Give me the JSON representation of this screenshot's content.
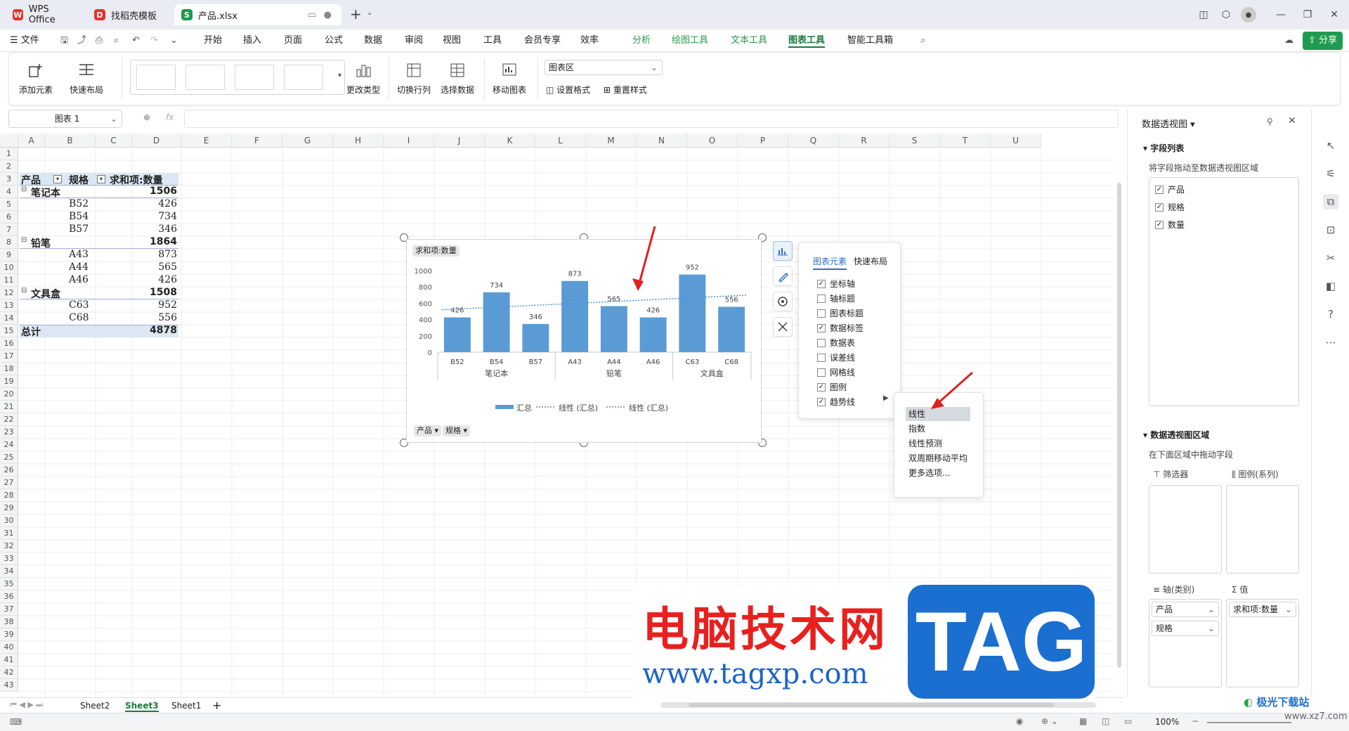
{
  "tabs": {
    "wps": "WPS Office",
    "template": "找稻壳模板",
    "file": "产品.xlsx",
    "new_tab": "+"
  },
  "menu": {
    "file": "文件",
    "items": [
      "开始",
      "插入",
      "页面",
      "公式",
      "数据",
      "审阅",
      "视图",
      "工具",
      "会员专享",
      "效率"
    ],
    "green_items": [
      "分析",
      "绘图工具",
      "文本工具"
    ],
    "active": "图表工具",
    "last": "智能工具箱",
    "share": "分享"
  },
  "ribbon": {
    "add_element": "添加元素",
    "quick_layout": "快速布局",
    "change_type": "更改类型",
    "switch_rowcol": "切换行列",
    "select_data": "选择数据",
    "move_chart": "移动图表",
    "area_select": "图表区",
    "set_format": "设置格式",
    "reset_style": "重置样式"
  },
  "formula": {
    "name_box": "图表 1",
    "fx": "fx"
  },
  "grid": {
    "columns": [
      "A",
      "B",
      "C",
      "D",
      "E",
      "F",
      "G",
      "H",
      "I",
      "J",
      "K",
      "L",
      "M",
      "N",
      "O",
      "P",
      "Q",
      "R",
      "S",
      "T",
      "U"
    ],
    "rows": [
      "1",
      "2",
      "3",
      "4",
      "5",
      "6",
      "7",
      "8",
      "9",
      "10",
      "11",
      "12",
      "13",
      "14",
      "15",
      "16",
      "17",
      "18",
      "19",
      "20",
      "21",
      "22",
      "23",
      "24",
      "25",
      "26",
      "27",
      "28",
      "29",
      "30",
      "31",
      "32",
      "33",
      "34",
      "35",
      "36",
      "37",
      "38",
      "39",
      "40",
      "41",
      "42",
      "43"
    ],
    "pivot": {
      "h_product": "产品",
      "h_spec": "规格",
      "h_sum": "求和项:数量",
      "rows": [
        {
          "a": "笔记本",
          "b": "",
          "c": "1506",
          "kind": "group"
        },
        {
          "a": "",
          "b": "B52",
          "c": "426",
          "kind": "item"
        },
        {
          "a": "",
          "b": "B54",
          "c": "734",
          "kind": "item"
        },
        {
          "a": "",
          "b": "B57",
          "c": "346",
          "kind": "item"
        },
        {
          "a": "铅笔",
          "b": "",
          "c": "1864",
          "kind": "group"
        },
        {
          "a": "",
          "b": "A43",
          "c": "873",
          "kind": "item"
        },
        {
          "a": "",
          "b": "A44",
          "c": "565",
          "kind": "item"
        },
        {
          "a": "",
          "b": "A46",
          "c": "426",
          "kind": "item"
        },
        {
          "a": "文具盒",
          "b": "",
          "c": "1508",
          "kind": "group"
        },
        {
          "a": "",
          "b": "C63",
          "c": "952",
          "kind": "item"
        },
        {
          "a": "",
          "b": "C68",
          "c": "556",
          "kind": "item"
        }
      ],
      "total_label": "总计",
      "total_value": "4878"
    }
  },
  "chart_data": {
    "type": "bar",
    "value_field_button": "求和项:数量",
    "categories": [
      "B52",
      "B54",
      "B57",
      "A43",
      "A44",
      "A46",
      "C63",
      "C68"
    ],
    "groups": [
      {
        "name": "笔记本",
        "count": 3
      },
      {
        "name": "铅笔",
        "count": 3
      },
      {
        "name": "文具盒",
        "count": 2
      }
    ],
    "series": [
      {
        "name": "汇总",
        "values": [
          426,
          734,
          346,
          873,
          565,
          426,
          952,
          556
        ],
        "color": "#5b9bd5"
      }
    ],
    "data_labels": [
      "426",
      "734",
      "346",
      "873",
      "565",
      "426",
      "952",
      "556"
    ],
    "trendline": {
      "type": "linear",
      "color": "#4a90d9"
    },
    "ylim": [
      0,
      1000
    ],
    "y_ticks": [
      "0",
      "200",
      "400",
      "600",
      "800",
      "1000"
    ],
    "legend": {
      "position": "bottom",
      "entries": [
        "汇总",
        "线性 (汇总)",
        "线性 (汇总)"
      ]
    },
    "field_buttons": [
      "产品",
      "规格"
    ]
  },
  "chart_elements_panel": {
    "tab_elements": "图表元素",
    "tab_layout": "快速布局",
    "items": [
      {
        "label": "坐标轴",
        "checked": true
      },
      {
        "label": "轴标题",
        "checked": false
      },
      {
        "label": "图表标题",
        "checked": false
      },
      {
        "label": "数据标签",
        "checked": true
      },
      {
        "label": "数据表",
        "checked": false
      },
      {
        "label": "误差线",
        "checked": false
      },
      {
        "label": "网格线",
        "checked": false
      },
      {
        "label": "图例",
        "checked": true
      },
      {
        "label": "趋势线",
        "checked": true
      }
    ],
    "submenu": [
      "线性",
      "指数",
      "线性预测",
      "双周期移动平均",
      "更多选项..."
    ]
  },
  "pivot_pane": {
    "title": "数据透视图",
    "field_list": "字段列表",
    "drag_hint": "将字段拖动至数据透视图区域",
    "fields": [
      {
        "label": "产品",
        "checked": true
      },
      {
        "label": "规格",
        "checked": true
      },
      {
        "label": "数量",
        "checked": true
      }
    ],
    "area_title": "数据透视图区域",
    "area_hint": "在下面区域中拖动字段",
    "filter": "筛选器",
    "legend_series": "图例(系列)",
    "axis_category": "轴(类别)",
    "values": "值",
    "axis_fields": [
      "产品",
      "规格"
    ],
    "value_fields": [
      "求和项:数量"
    ]
  },
  "sheets": {
    "tabs": [
      "Sheet2",
      "Sheet3",
      "Sheet1"
    ],
    "active": "Sheet3",
    "add": "+"
  },
  "status": {
    "zoom": "100%"
  },
  "watermark": {
    "cn": "电脑技术网",
    "url": "www.tagxp.com",
    "tag": "TAG",
    "corner": "极光下载站",
    "corner_url": "www.xz7.com"
  }
}
